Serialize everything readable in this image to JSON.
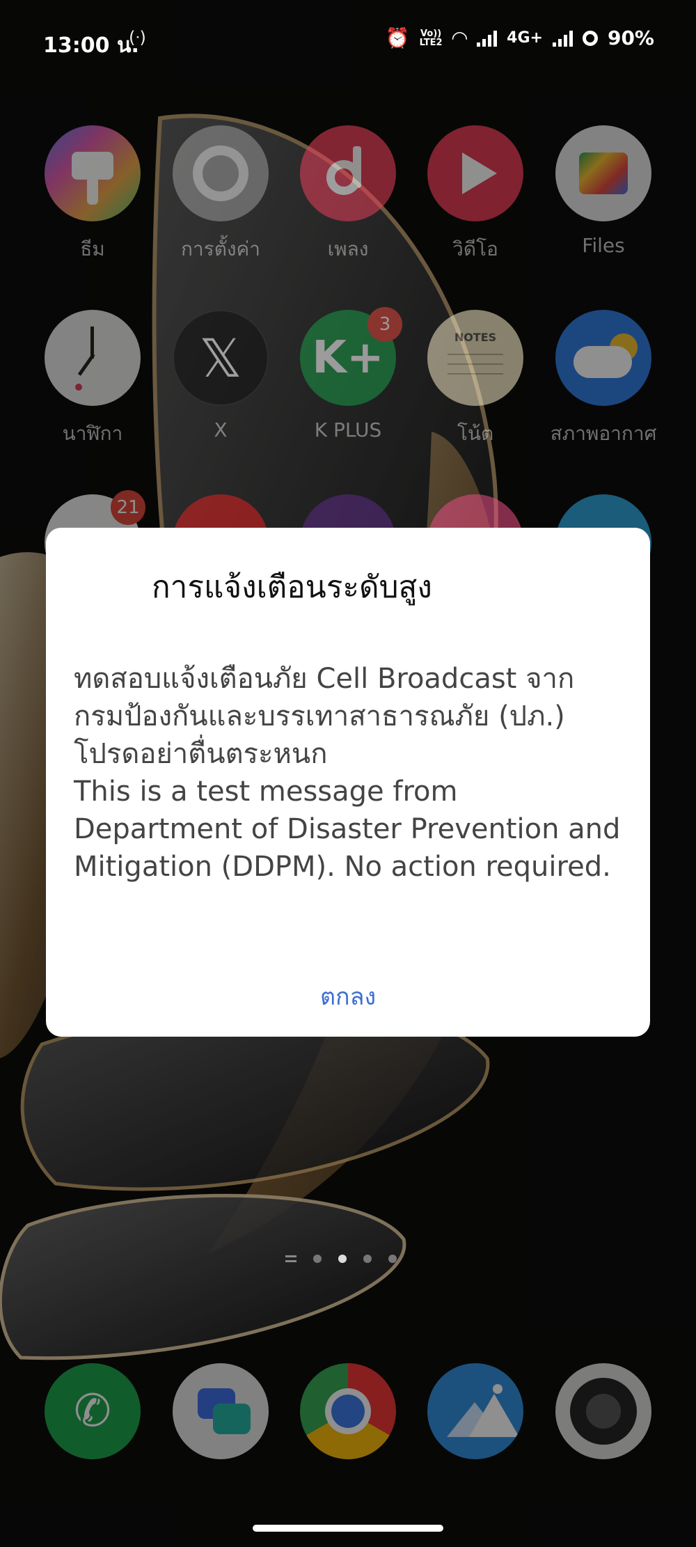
{
  "status_bar": {
    "time": "13:00 น.",
    "cast_glyph": "(ᐧ)",
    "volte_top": "Vo))",
    "volte_bottom": "LTE2",
    "network": "4G+",
    "battery": "90%"
  },
  "apps": [
    {
      "label": "ธีม",
      "icon": "theme-icon"
    },
    {
      "label": "การตั้งค่า",
      "icon": "settings-gear-icon"
    },
    {
      "label": "เพลง",
      "icon": "music-note-icon"
    },
    {
      "label": "วิดีโอ",
      "icon": "video-play-icon"
    },
    {
      "label": "Files",
      "icon": "files-folder-icon"
    },
    {
      "label": "นาฬิกา",
      "icon": "clock-icon"
    },
    {
      "label": "X",
      "icon": "x-logo-icon",
      "glyph": "𝕏"
    },
    {
      "label": "K PLUS",
      "icon": "kplus-logo-icon",
      "glyph": "K+",
      "badge": "3"
    },
    {
      "label": "โน้ต",
      "icon": "notes-icon",
      "glyph": "NOTES"
    },
    {
      "label": "สภาพอากาศ",
      "icon": "weather-icon"
    }
  ],
  "row3_badge": "21",
  "dialog": {
    "title": "การแจ้งเตือนระดับสูง",
    "body_th_1": "ทดสอบแจ้งเตือนภัย Cell Broadcast จาก",
    "body_th_2": "กรมป้องกันและบรรเทาสาธารณภัย (ปภ.)",
    "body_th_3": "โปรดอย่าตื่นตระหนก",
    "body_en": "This is a test message from Department of Disaster Prevention and Mitigation (DDPM). No action required.",
    "ok_label": "ตกลง"
  },
  "dock": [
    {
      "icon": "phone-icon"
    },
    {
      "icon": "messages-icon"
    },
    {
      "icon": "chrome-icon"
    },
    {
      "icon": "gallery-icon"
    },
    {
      "icon": "camera-icon"
    }
  ],
  "colors": {
    "dialog_bg": "#ffffff",
    "accent": "#3d6fd1",
    "badge": "#e0463b"
  }
}
